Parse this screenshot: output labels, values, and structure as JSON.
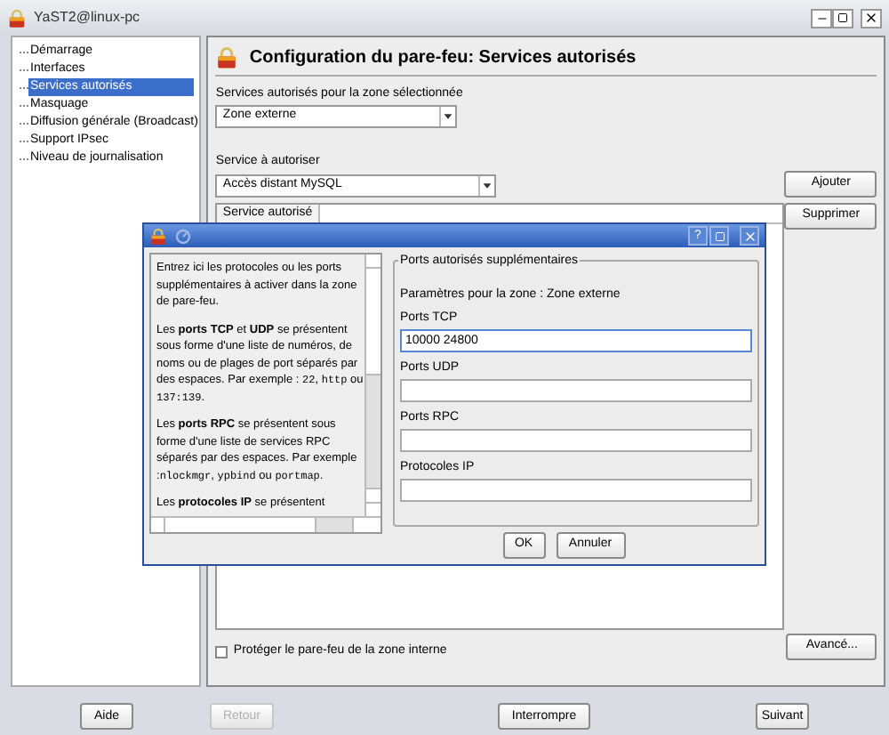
{
  "window": {
    "title": "YaST2@linux-pc"
  },
  "sidebar": {
    "items": [
      {
        "label": "Démarrage",
        "selected": false
      },
      {
        "label": "Interfaces",
        "selected": false
      },
      {
        "label": "Services autorisés",
        "selected": true
      },
      {
        "label": "Masquage",
        "selected": false
      },
      {
        "label": "Diffusion générale (Broadcast)",
        "selected": false
      },
      {
        "label": "Support IPsec",
        "selected": false
      },
      {
        "label": "Niveau de journalisation",
        "selected": false
      }
    ]
  },
  "page": {
    "title": "Configuration du pare-feu: Services autorisés",
    "zone_label": "Services autorisés pour la zone sélectionnée",
    "zone_value": "Zone externe",
    "service_label": "Service à autoriser",
    "service_value": "Accès distant MySQL",
    "add_button": "Ajouter",
    "remove_button": "Supprimer",
    "table": {
      "columns": [
        "Service autorisé"
      ]
    },
    "protect_checkbox": {
      "label": "Protéger le pare-feu de la zone interne",
      "checked": false
    },
    "advanced_button": "Avancé..."
  },
  "dialog": {
    "help_button": "?",
    "help": [
      [
        {
          "kind": "plain",
          "text": "Entrez ici les protocoles ou les ports supplémentaires à activer dans la zone de pare-feu."
        }
      ],
      [
        {
          "kind": "plain",
          "text": "Les "
        },
        {
          "kind": "bold",
          "text": "ports TCP"
        },
        {
          "kind": "plain",
          "text": " et "
        },
        {
          "kind": "bold",
          "text": "UDP"
        },
        {
          "kind": "plain",
          "text": " se présentent sous forme d'une liste de numéros, de noms ou de plages de port séparés par des espaces. Par exemple : "
        },
        {
          "kind": "code",
          "text": "22"
        },
        {
          "kind": "plain",
          "text": ", "
        },
        {
          "kind": "code",
          "text": "http"
        },
        {
          "kind": "plain",
          "text": " ou "
        },
        {
          "kind": "code",
          "text": "137:139"
        },
        {
          "kind": "plain",
          "text": "."
        }
      ],
      [
        {
          "kind": "plain",
          "text": "Les "
        },
        {
          "kind": "bold",
          "text": "ports RPC"
        },
        {
          "kind": "plain",
          "text": " se présentent sous forme d'une liste de services RPC séparés par des espaces. Par exemple :"
        },
        {
          "kind": "code",
          "text": "nlockmgr"
        },
        {
          "kind": "plain",
          "text": ", "
        },
        {
          "kind": "code",
          "text": "ypbind"
        },
        {
          "kind": "plain",
          "text": " ou "
        },
        {
          "kind": "code",
          "text": "portmap"
        },
        {
          "kind": "plain",
          "text": "."
        }
      ],
      [
        {
          "kind": "plain",
          "text": "Les "
        },
        {
          "kind": "bold",
          "text": "protocoles IP"
        },
        {
          "kind": "plain",
          "text": " se présentent"
        }
      ]
    ],
    "group_title": "Ports autorisés supplémentaires",
    "zone_text": "Paramètres pour la zone : Zone externe",
    "fields": [
      {
        "label": "Ports TCP",
        "value": "10000 24800",
        "focused": true
      },
      {
        "label": "Ports UDP",
        "focused": false
      },
      {
        "label": "Ports RPC",
        "focused": false
      },
      {
        "label": "Protocoles IP",
        "focused": false
      }
    ],
    "ok_button": "OK",
    "cancel_button": "Annuler"
  },
  "footer": {
    "buttons": [
      {
        "label": "Aide",
        "disabled": false
      },
      {
        "label": "Retour",
        "disabled": true
      },
      {
        "label": "Interrompre",
        "disabled": false
      },
      {
        "label": "Suivant",
        "disabled": false
      }
    ]
  }
}
